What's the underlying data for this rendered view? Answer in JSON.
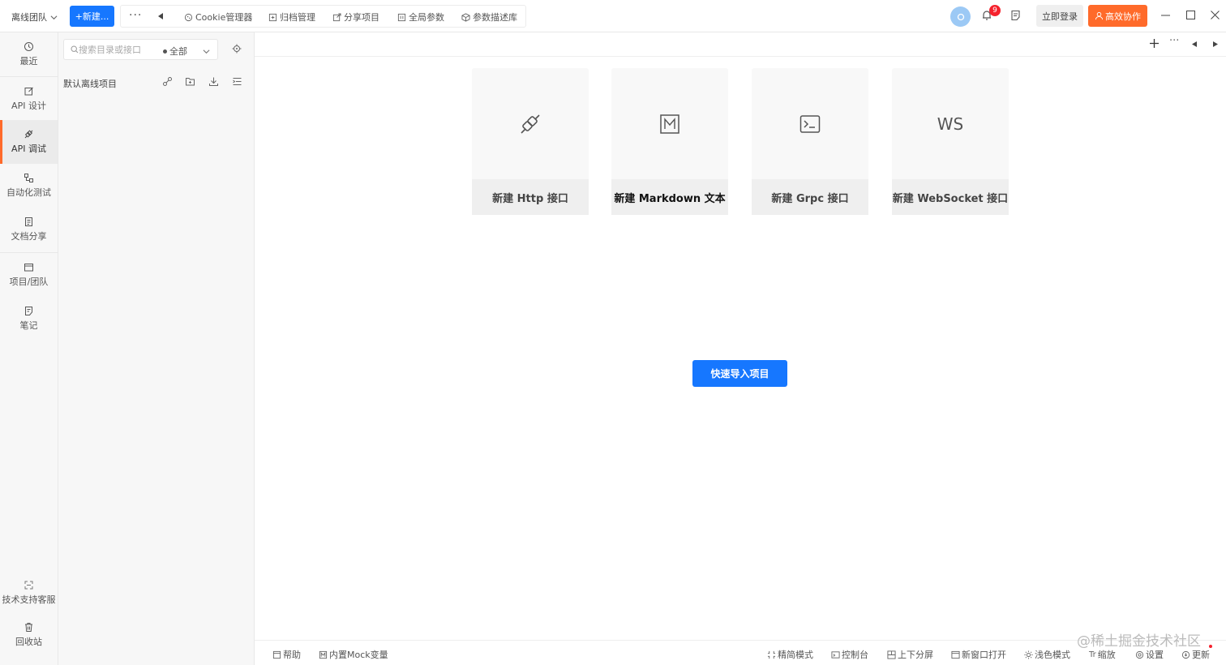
{
  "topbar": {
    "team": "离线团队",
    "new_button": "+新建...",
    "tools": [
      "Cookie管理器",
      "归档管理",
      "分享项目",
      "全局参数",
      "参数描述库"
    ],
    "notifications": "9",
    "login": "立即登录",
    "collab": "高效协作"
  },
  "nav": {
    "items": [
      {
        "label": "最近",
        "icon": "clock-icon"
      },
      {
        "label": "API 设计",
        "icon": "edit-icon"
      },
      {
        "label": "API 调试",
        "icon": "plug-icon",
        "active": true
      },
      {
        "label": "自动化测试",
        "icon": "flow-icon"
      },
      {
        "label": "文档分享",
        "icon": "doc-icon"
      },
      {
        "label": "项目/团队",
        "icon": "folder-icon"
      },
      {
        "label": "笔记",
        "icon": "note-icon"
      }
    ],
    "support": "技术支持客服",
    "trash": "回收站"
  },
  "tree": {
    "search_placeholder": "搜索目录或接口",
    "filter": "全部",
    "project": "默认离线项目"
  },
  "cards": [
    {
      "label": "新建 Http 接口",
      "icon": "plug-icon"
    },
    {
      "label": "新建 Markdown 文本",
      "icon": "markdown-icon"
    },
    {
      "label": "新建 Grpc 接口",
      "icon": "terminal-icon"
    },
    {
      "label": "新建 WebSocket 接口",
      "icon": "ws-text",
      "icon_text": "WS"
    }
  ],
  "import_button": "快速导入项目",
  "bottom": {
    "left": [
      "帮助",
      "内置Mock变量"
    ],
    "right": [
      "精简模式",
      "控制台",
      "上下分屏",
      "新窗口打开",
      "浅色模式",
      "缩放",
      "设置",
      "更新"
    ]
  },
  "watermark": "@稀土掘金技术社区",
  "colors": {
    "primary": "#1677ff",
    "accent": "#ff6a2a",
    "badge": "#f5222d"
  }
}
